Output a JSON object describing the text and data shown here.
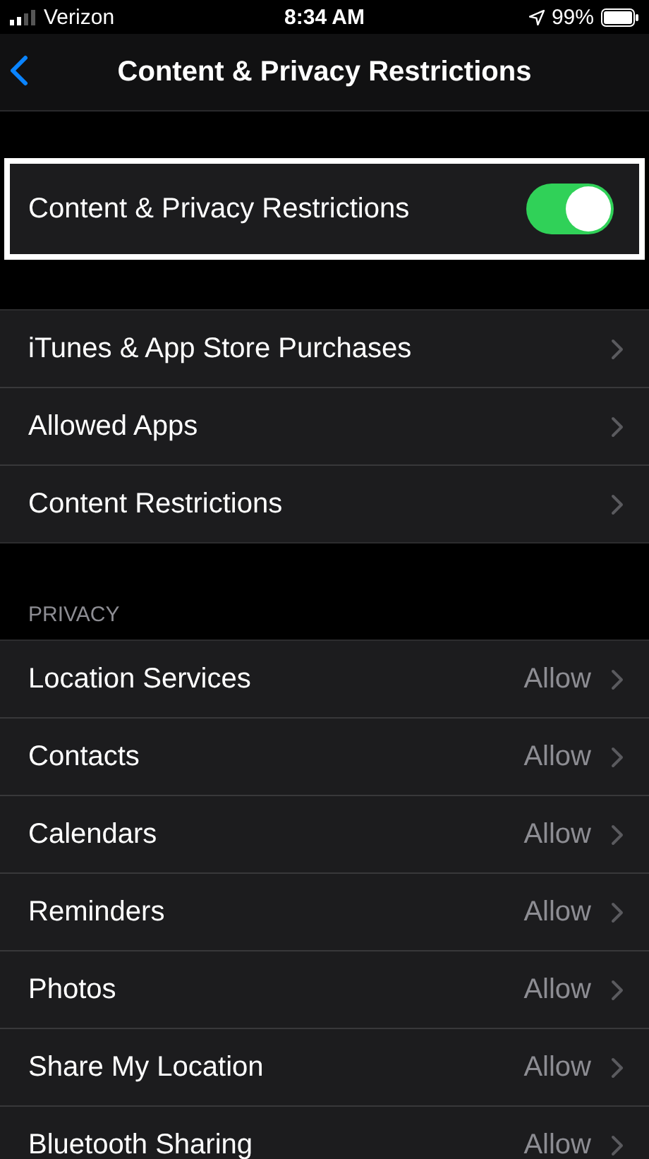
{
  "status_bar": {
    "carrier": "Verizon",
    "time": "8:34 AM",
    "battery": "99%"
  },
  "nav": {
    "title": "Content & Privacy Restrictions"
  },
  "main_toggle": {
    "label": "Content & Privacy Restrictions",
    "on": true,
    "highlighted": true
  },
  "settings": [
    {
      "label": "iTunes & App Store Purchases"
    },
    {
      "label": "Allowed Apps"
    },
    {
      "label": "Content Restrictions"
    }
  ],
  "privacy": {
    "header": "PRIVACY",
    "rows": [
      {
        "label": "Location Services",
        "value": "Allow"
      },
      {
        "label": "Contacts",
        "value": "Allow"
      },
      {
        "label": "Calendars",
        "value": "Allow"
      },
      {
        "label": "Reminders",
        "value": "Allow"
      },
      {
        "label": "Photos",
        "value": "Allow"
      },
      {
        "label": "Share My Location",
        "value": "Allow"
      },
      {
        "label": "Bluetooth Sharing",
        "value": "Allow"
      }
    ]
  }
}
